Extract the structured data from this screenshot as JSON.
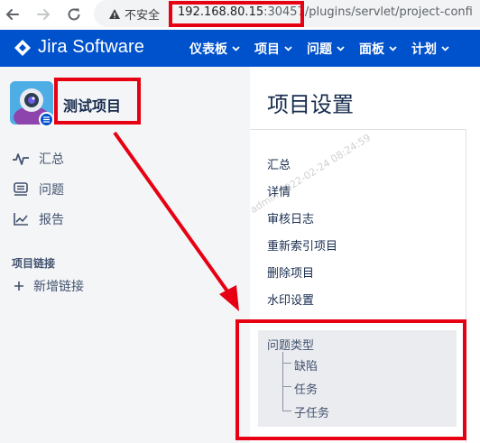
{
  "browser": {
    "insecure_label": "不安全",
    "url_host": "192.168.80.15",
    "url_port": ":30457",
    "url_path": "/plugins/servlet/project-confi"
  },
  "topbar": {
    "logo_text": "Jira Software",
    "menu": [
      {
        "label": "仪表板"
      },
      {
        "label": "项目"
      },
      {
        "label": "问题"
      },
      {
        "label": "面板"
      },
      {
        "label": "计划"
      }
    ]
  },
  "sidebar": {
    "project_name": "测试项目",
    "links": [
      {
        "label": "汇总",
        "icon": "pulse-icon"
      },
      {
        "label": "问题",
        "icon": "issues-icon"
      },
      {
        "label": "报告",
        "icon": "chart-icon"
      }
    ],
    "section_title": "项目链接",
    "add_link_label": "新增链接"
  },
  "main": {
    "title": "项目设置",
    "settings_items": [
      {
        "label": "汇总"
      },
      {
        "label": "详情"
      },
      {
        "label": "审核日志"
      },
      {
        "label": "重新索引项目"
      },
      {
        "label": "删除项目"
      },
      {
        "label": "水印设置"
      }
    ],
    "issue_types": {
      "label": "问题类型",
      "children": [
        {
          "label": "缺陷"
        },
        {
          "label": "任务"
        },
        {
          "label": "子任务"
        }
      ]
    }
  },
  "watermark_text": "admin 2022-02-24 08:24:59",
  "colors": {
    "jira_blue": "#0052cc",
    "sidebar_bg": "#f4f5f7",
    "annotation_red": "#e60012"
  }
}
